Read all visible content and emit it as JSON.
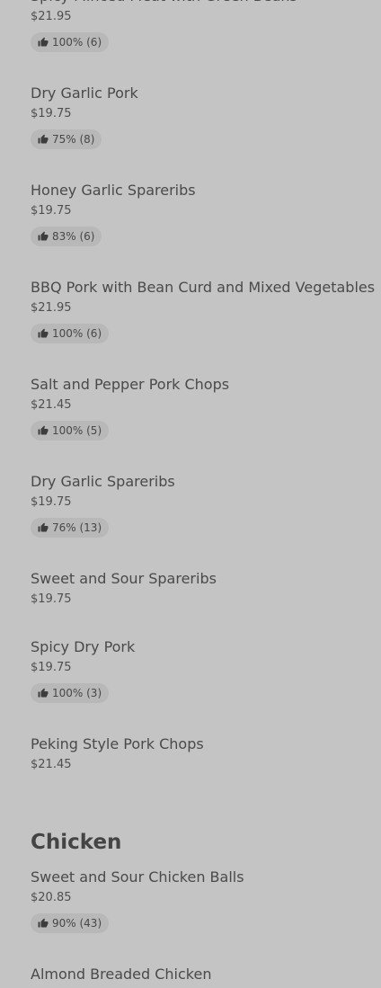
{
  "items": [
    {
      "name": "Spicy Minced Meat with Green Beans",
      "price": "$21.95",
      "rating": "100% (6)"
    },
    {
      "name": "Dry Garlic Pork",
      "price": "$19.75",
      "rating": "75% (8)"
    },
    {
      "name": "Honey Garlic Spareribs",
      "price": "$19.75",
      "rating": "83% (6)"
    },
    {
      "name": "BBQ Pork with Bean Curd and Mixed Vegetables",
      "price": "$21.95",
      "rating": "100% (6)"
    },
    {
      "name": "Salt and Pepper Pork Chops",
      "price": "$21.45",
      "rating": "100% (5)"
    },
    {
      "name": "Dry Garlic Spareribs",
      "price": "$19.75",
      "rating": "76% (13)"
    },
    {
      "name": "Sweet and Sour Spareribs",
      "price": "$19.75"
    },
    {
      "name": "Spicy Dry Pork",
      "price": "$19.75",
      "rating": "100% (3)"
    },
    {
      "name": "Peking Style Pork Chops",
      "price": "$21.45"
    }
  ],
  "section": {
    "title": "Chicken"
  },
  "chicken_items": [
    {
      "name": "Sweet and Sour Chicken Balls",
      "price": "$20.85",
      "rating": "90% (43)"
    },
    {
      "name": "Almond Breaded Chicken"
    }
  ],
  "colors": {
    "background": "#c4c4c4",
    "pill": "#b8b8b8",
    "text": "#494949"
  },
  "icons": {
    "rating": "thumbs-up-icon"
  }
}
